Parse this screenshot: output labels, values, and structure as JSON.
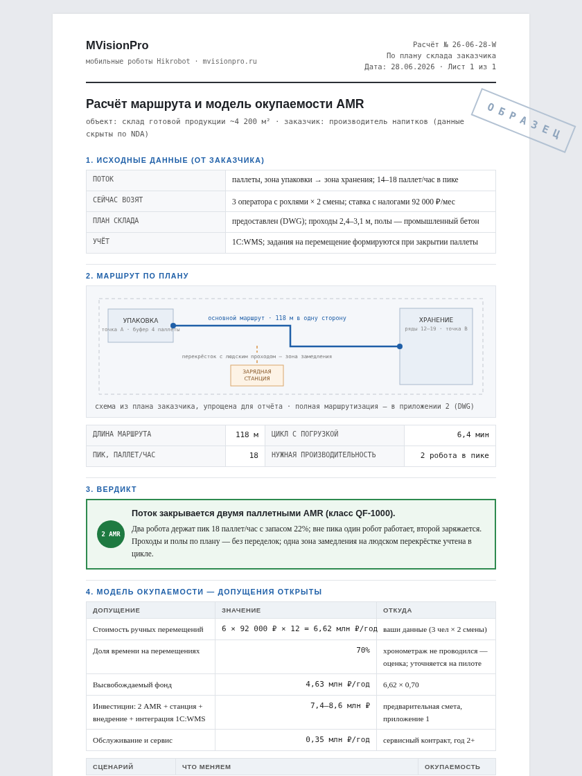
{
  "header": {
    "brand": "MVisionPro",
    "tagline": "мобильные роботы Hikrobot · mvisionpro.ru",
    "meta": [
      "Расчёт № 26-06-28-W",
      "По плану склада заказчика",
      "Дата: 28.06.2026 · Лист 1 из 1"
    ]
  },
  "stamp": "ОБРАЗЕЦ",
  "title": "Расчёт маршрута и модель окупаемости AMR",
  "subtitle": "объект: склад готовой продукции ~4 200 м² · заказчик: производитель напитков (данные скрыты по NDA)",
  "sections": [
    {
      "kind": "kv",
      "heading": "1. ИСХОДНЫЕ ДАННЫЕ (ОТ ЗАКАЗЧИКА)",
      "rows": [
        {
          "label": "ПОТОК",
          "value": "паллеты, зона упаковки → зона хранения; 14–18 паллет/час в пике"
        },
        {
          "label": "СЕЙЧАС ВОЗЯТ",
          "value": "3 оператора с рохлями × 2 смены; ставка с налогами 92 000 ₽/мес"
        },
        {
          "label": "ПЛАН СКЛАДА",
          "value": "предоставлен (DWG); проходы 2,4–3,1 м, полы — промышленный бетон"
        },
        {
          "label": "УЧЁТ",
          "value": "1С:WMS; задания на перемещение формируются при закрытии паллеты"
        }
      ]
    },
    {
      "kind": "route",
      "heading": "2. МАРШРУТ ПО ПЛАНУ",
      "diagram": {
        "start": {
          "label": "УПАКОВКА",
          "sublabel": "точка А · буфер 4 паллеты"
        },
        "end": {
          "label": "ХРАНЕНИЕ",
          "sublabel": "ряды 12–19 · точка В"
        },
        "route_label": "основной маршрут · 118 м в одну сторону",
        "crossing_label": "перекрёсток с людским проходом — зона замедления",
        "station_lines": [
          "ЗАРЯДНАЯ",
          "СТАНЦИЯ"
        ]
      },
      "caption": "схема из плана заказчика, упрощена для отчёта · полная маршрутизация — в приложении 2 (DWG)",
      "metrics": [
        {
          "label": "ДЛИНА МАРШРУТА",
          "value": "118 м"
        },
        {
          "label": "ЦИКЛ С ПОГРУЗКОЙ",
          "value": "6,4 мин"
        },
        {
          "label": "ПИК, ПАЛЛЕТ/ЧАС",
          "value": "18"
        },
        {
          "label": "НУЖНАЯ ПРОИЗВОДИТЕЛЬНОСТЬ",
          "value": "2 робота в пике"
        }
      ]
    },
    {
      "kind": "verdict",
      "heading": "3. ВЕРДИКТ",
      "badge": "2 AMR",
      "title": "Поток закрывается двумя паллетными AMR (класс QF-1000).",
      "text": "Два робота держат пик 18 паллет/час с запасом 22%; вне пика один робот работает, второй заряжается. Проходы и полы по плану — без переделок; одна зона замедления на людском перекрёстке учтена в цикле."
    },
    {
      "kind": "tables",
      "heading": "4. МОДЕЛЬ ОКУПАЕМОСТИ — ДОПУЩЕНИЯ ОТКРЫТЫ",
      "tables": [
        {
          "columns": [
            "ДОПУЩЕНИЕ",
            "ЗНАЧЕНИЕ",
            "ОТКУДА"
          ],
          "rows": [
            [
              "Стоимость ручных перемещений",
              "6 × 92 000 ₽ × 12 = 6,62 млн ₽/год",
              "ваши данные (3 чел × 2 смены)"
            ],
            [
              "Доля времени на перемещениях",
              "70%",
              "хронометраж не проводился — оценка; уточняется на пилоте"
            ],
            [
              "Высвобождаемый фонд",
              "4,63 млн ₽/год",
              "6,62 × 0,70"
            ],
            [
              "Инвестиции: 2 AMR + станция + внедрение + интеграция 1С:WMS",
              "7,4–8,6 млн ₽",
              "предварительная смета, приложение 1"
            ],
            [
              "Обслуживание и сервис",
              "0,35 млн ₽/год",
              "сервисный контракт, год 2+"
            ]
          ]
        },
        {
          "columns": [
            "СЦЕНАРИЙ",
            "ЧТО МЕНЯЕМ",
            "ОКУПАЕМОСТЬ"
          ]
        }
      ]
    }
  ]
}
